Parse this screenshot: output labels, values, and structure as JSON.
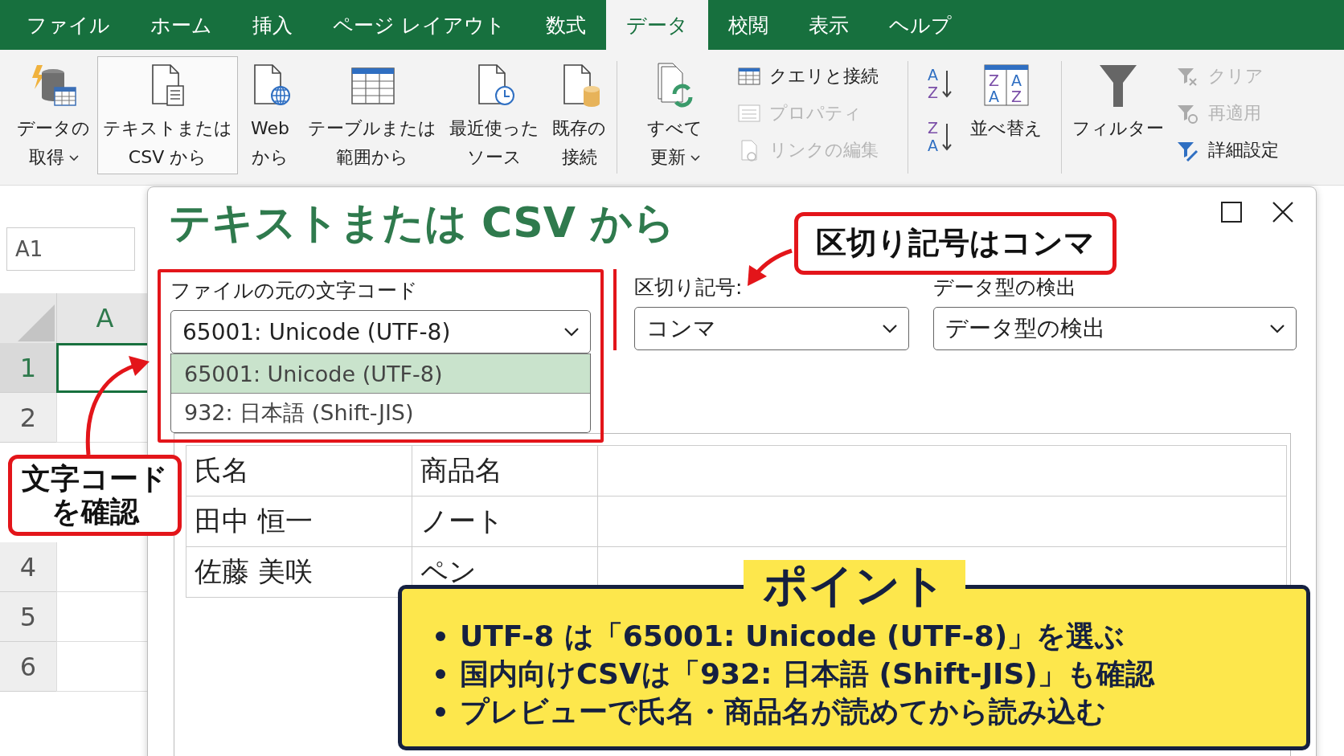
{
  "menu_tabs": [
    {
      "label": "ファイル",
      "selected": false
    },
    {
      "label": "ホーム",
      "selected": false
    },
    {
      "label": "挿入",
      "selected": false
    },
    {
      "label": "ページ レイアウト",
      "selected": false
    },
    {
      "label": "数式",
      "selected": false
    },
    {
      "label": "データ",
      "selected": true
    },
    {
      "label": "校閲",
      "selected": false
    },
    {
      "label": "表示",
      "selected": false
    },
    {
      "label": "ヘルプ",
      "selected": false
    }
  ],
  "ribbon": {
    "get_data": [
      {
        "kind": "database",
        "lines": [
          "データの",
          "取得"
        ],
        "caret": true,
        "selected": false
      },
      {
        "kind": "text-file",
        "lines": [
          "テキストまたは",
          "CSV から"
        ],
        "caret": false,
        "selected": true
      },
      {
        "kind": "web",
        "lines": [
          "Web",
          "から"
        ],
        "caret": false,
        "selected": false
      },
      {
        "kind": "table",
        "lines": [
          "テーブルまたは",
          "範囲から"
        ],
        "caret": false,
        "selected": false
      },
      {
        "kind": "recent",
        "lines": [
          "最近使った",
          "ソース"
        ],
        "caret": false,
        "selected": false
      },
      {
        "kind": "existing",
        "lines": [
          "既存の",
          "接続"
        ],
        "caret": false,
        "selected": false
      }
    ],
    "refresh": {
      "lines": [
        "すべて",
        "更新"
      ],
      "caret": true
    },
    "queries": [
      {
        "kind": "queries",
        "label": "クエリと接続",
        "disabled": false
      },
      {
        "kind": "properties",
        "label": "プロパティ",
        "disabled": true
      },
      {
        "kind": "links",
        "label": "リンクの編集",
        "disabled": true
      }
    ],
    "sort_ascending": {
      "letters": [
        "A",
        "Z"
      ]
    },
    "sort_descending": {
      "letters": [
        "Z",
        "A"
      ]
    },
    "sort": {
      "label": "並べ替え",
      "letters": [
        "Z",
        "A",
        "A",
        "Z"
      ]
    },
    "filter": {
      "label": "フィルター"
    },
    "filter_options": [
      {
        "kind": "clear",
        "label": "クリア",
        "disabled": true
      },
      {
        "kind": "reapply",
        "label": "再適用",
        "disabled": true
      },
      {
        "kind": "advanced",
        "label": "詳細設定",
        "disabled": false
      }
    ]
  },
  "sheet": {
    "name_box": "A1",
    "column": "A",
    "rows": [
      {
        "label": "1",
        "selected": true
      },
      {
        "label": "2",
        "selected": false
      },
      null,
      null,
      {
        "label": "4",
        "selected": false
      },
      {
        "label": "5",
        "selected": false
      },
      {
        "label": "6",
        "selected": false
      }
    ]
  },
  "dialog": {
    "title": "テキストまたは CSV から",
    "encoding": {
      "label": "ファイルの元の文字コード",
      "value": "65001: Unicode (UTF-8)",
      "options": [
        {
          "label": "65001: Unicode (UTF-8)",
          "selected": true
        },
        {
          "label": "932: 日本語 (Shift-JIS)",
          "selected": false
        }
      ]
    },
    "delimiter": {
      "label": "区切り記号:",
      "value": "コンマ"
    },
    "detection": {
      "label": "データ型の検出",
      "value": "データ型の検出"
    },
    "preview": {
      "rows": [
        [
          "氏名",
          "商品名"
        ],
        [
          "田中 恒一",
          "ノート"
        ],
        [
          "佐藤 美咲",
          "ペン"
        ]
      ]
    }
  },
  "callouts": [
    {
      "kind": "delimiter",
      "lines": [
        "区切り記号はコンマ"
      ]
    },
    {
      "kind": "encoding",
      "lines": [
        "文字コード",
        "を確認"
      ]
    }
  ],
  "point": {
    "title": "ポイント",
    "bullets": [
      "UTF-8 は「65001: Unicode (UTF-8)」を選ぶ",
      "国内向けCSVは「932: 日本語 (Shift-JIS)」も確認",
      "プレビューで氏名・商品名が読めてから読み込む"
    ]
  }
}
